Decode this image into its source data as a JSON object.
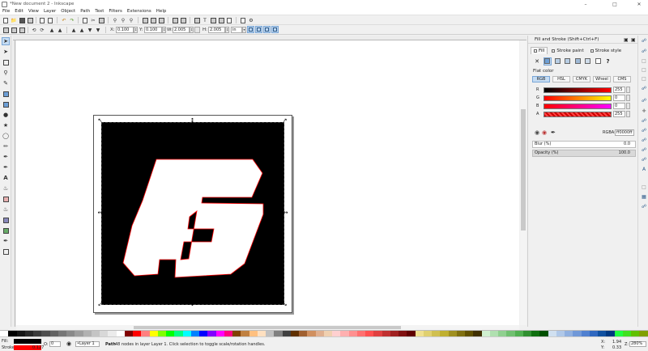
{
  "window": {
    "title": "*New document 2 - Inkscape",
    "minimize": "–",
    "maximize": "□",
    "close": "✕"
  },
  "menu": [
    "File",
    "Edit",
    "View",
    "Layer",
    "Object",
    "Path",
    "Text",
    "Filters",
    "Extensions",
    "Help"
  ],
  "controls": {
    "x_label": "X:",
    "x_value": "0.100",
    "y_label": "Y:",
    "y_value": "0.100",
    "w_label": "W:",
    "w_value": "2.005",
    "h_label": "H:",
    "h_value": "2.005",
    "unit": "in"
  },
  "panel": {
    "title": "Fill and Stroke (Shift+Ctrl+F)",
    "tabs": [
      "Fill",
      "Stroke paint",
      "Stroke style"
    ],
    "flat_color_label": "Flat color",
    "modes": [
      "RGB",
      "HSL",
      "CMYK",
      "Wheel",
      "CMS"
    ],
    "channels": [
      {
        "label": "R",
        "value": "255"
      },
      {
        "label": "G",
        "value": "0"
      },
      {
        "label": "B",
        "value": "0"
      },
      {
        "label": "A",
        "value": "255"
      }
    ],
    "rgba_label": "RGBA:",
    "rgba_value": "ff0000ff",
    "blur_label": "Blur (%)",
    "blur_value": "0.0",
    "blur_fraction": 0,
    "opacity_label": "Opacity (%)",
    "opacity_value": "100.0",
    "opacity_fraction": 1
  },
  "status": {
    "fill_label": "Fill:",
    "stroke_label": "Stroke:",
    "stroke_width": "0.127",
    "opacity_label": "O:",
    "opacity_value": "0",
    "layer_value": "•Layer 1",
    "message_bold": "Path",
    "message": " 48 nodes in layer Layer 1. Click selection to toggle scale/rotation handles.",
    "x_label": "X:",
    "x_value": "1.94",
    "y_label": "Y:",
    "y_value": "0.33",
    "zoom_label": "Z:",
    "zoom_value": "280%"
  },
  "colors": {
    "artwork_bg": "#000000",
    "logo": "#ffffff",
    "logo_outline": "#ff0000",
    "fill_color": "#000000",
    "stroke_color": "#ff0000",
    "accent": "#c5dcf3"
  }
}
